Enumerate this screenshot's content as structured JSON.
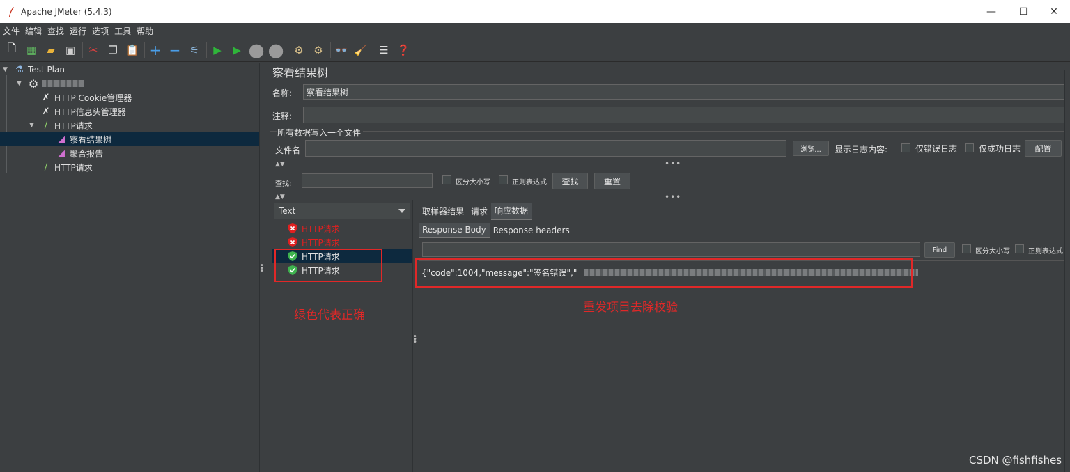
{
  "window": {
    "title": "Apache JMeter (5.4.3)"
  },
  "menu": [
    "文件",
    "编辑",
    "查找",
    "运行",
    "选项",
    "工具",
    "帮助"
  ],
  "toolbar_icons": [
    "new-icon",
    "templates-icon",
    "open-icon",
    "save-icon",
    "cut-icon",
    "copy-icon",
    "paste-icon",
    "expand-icon",
    "collapse-icon",
    "toggle-icon",
    "start-icon",
    "start-no-pause-icon",
    "stop-icon",
    "shutdown-icon",
    "clear-icon",
    "clear-all-icon",
    "search-icon",
    "reset-search-icon",
    "function-helper-icon",
    "help-icon"
  ],
  "tree": {
    "test_plan": "Test Plan",
    "cookie_manager": "HTTP Cookie管理器",
    "header_manager": "HTTP信息头管理器",
    "http_request_1": "HTTP请求",
    "view_results_tree": "察看结果树",
    "aggregate_report": "聚合报告",
    "http_request_2": "HTTP请求"
  },
  "panel": {
    "title": "察看结果树",
    "name_label": "名称:",
    "name_value": "察看结果树",
    "comment_label": "注释:",
    "comment_value": "",
    "file_section": "所有数据写入一个文件",
    "filename_label": "文件名",
    "filename_value": "",
    "browse_label": "浏览...",
    "log_label": "显示日志内容:",
    "errors_only": "仅错误日志",
    "success_only": "仅成功日志",
    "config_label": "配置",
    "search_label": "查找:",
    "search_value": "",
    "case_sensitive": "区分大小写",
    "regex": "正则表达式",
    "find_button": "查找",
    "reset_button": "重置"
  },
  "results": {
    "renderer": "Text",
    "rows": [
      {
        "label": "HTTP请求",
        "status": "error"
      },
      {
        "label": "HTTP请求",
        "status": "error"
      },
      {
        "label": "HTTP请求",
        "status": "success"
      },
      {
        "label": "HTTP请求",
        "status": "success"
      }
    ]
  },
  "tabs": {
    "sampler_result": "取样器结果",
    "request": "请求",
    "response_data": "响应数据"
  },
  "subtabs": {
    "body": "Response Body",
    "headers": "Response headers"
  },
  "response": {
    "find_value": "",
    "find_button": "Find",
    "case_sensitive": "区分大小写",
    "regex": "正则表达式",
    "text": "{\"code\":1004,\"message\":\"签名错误\",\""
  },
  "annotations": {
    "green_correct": "绿色代表正确",
    "resend": "重发项目去除校验"
  },
  "watermark": "CSDN @fishfishes",
  "colors": {
    "error": "#e02020",
    "success": "#3fb34f",
    "selected": "#0d293e",
    "annotation": "#e02828"
  }
}
